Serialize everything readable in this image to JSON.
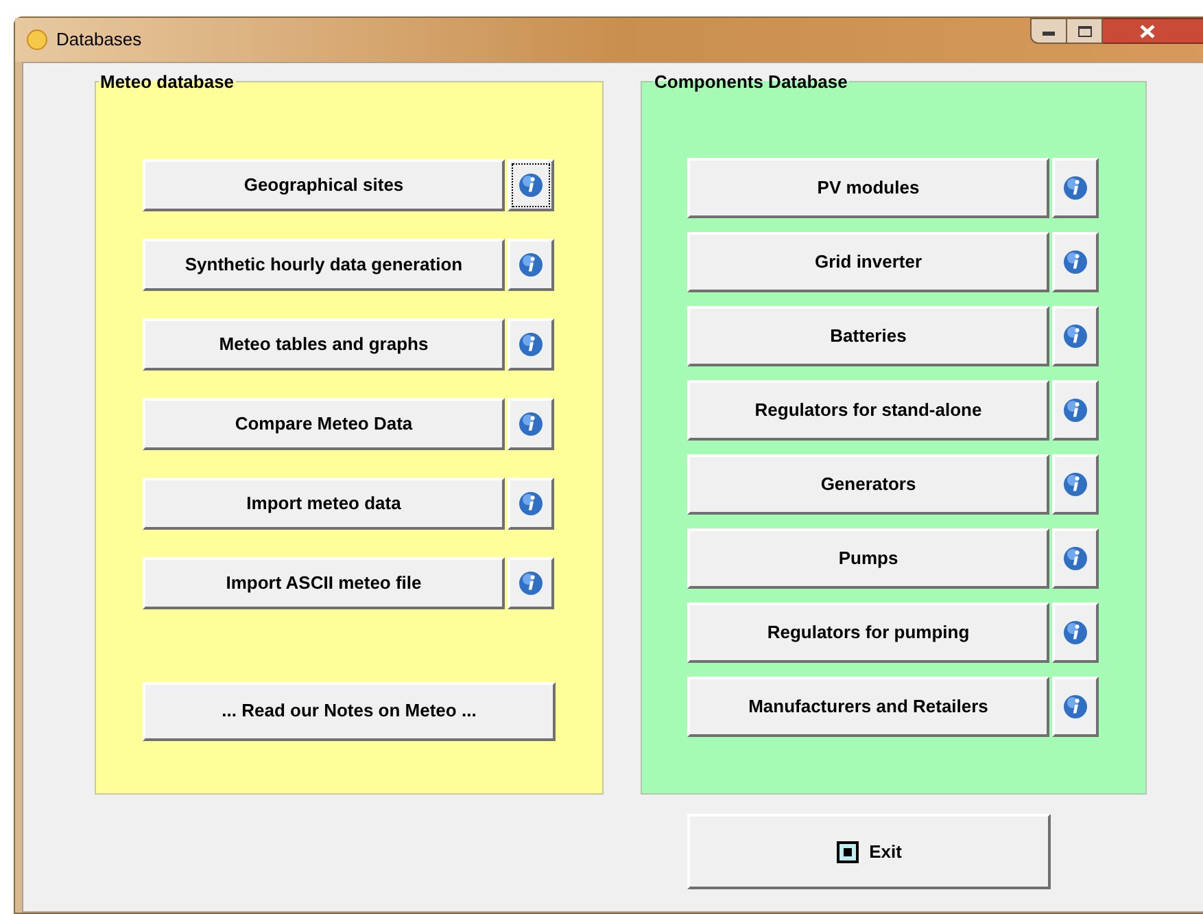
{
  "window": {
    "title": "Databases"
  },
  "meteo_database": {
    "title": "Meteo database",
    "buttons": [
      {
        "label": "Geographical sites",
        "info_focused": true
      },
      {
        "label": "Synthetic hourly data generation",
        "info_focused": false
      },
      {
        "label": "Meteo tables and graphs",
        "info_focused": false
      },
      {
        "label": "Compare Meteo Data",
        "info_focused": false
      },
      {
        "label": "Import meteo data",
        "info_focused": false
      },
      {
        "label": "Import ASCII meteo file",
        "info_focused": false
      }
    ],
    "notes_button": "... Read our Notes on Meteo ..."
  },
  "components_database": {
    "title": "Components Database",
    "buttons": [
      {
        "label": "PV modules",
        "info_focused": false
      },
      {
        "label": "Grid inverter",
        "info_focused": false
      },
      {
        "label": "Batteries",
        "info_focused": false
      },
      {
        "label": "Regulators for stand-alone",
        "info_focused": false
      },
      {
        "label": "Generators",
        "info_focused": false
      },
      {
        "label": "Pumps",
        "info_focused": false
      },
      {
        "label": "Regulators for pumping",
        "info_focused": false
      },
      {
        "label": "Manufacturers and Retailers",
        "info_focused": false
      }
    ]
  },
  "exit_button": "Exit"
}
